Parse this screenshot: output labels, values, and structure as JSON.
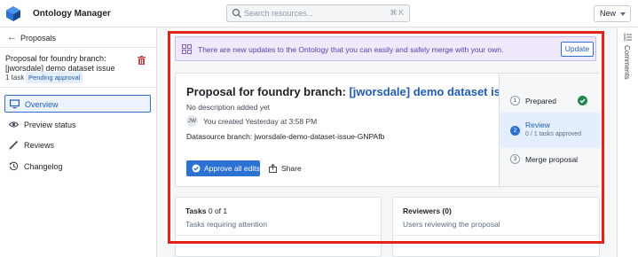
{
  "app": {
    "title": "Ontology Manager"
  },
  "search": {
    "placeholder": "Search resources...",
    "shortcut": "⌘ K"
  },
  "header": {
    "new_label": "New"
  },
  "sidebar": {
    "back_label": "Proposals",
    "proposal_name": "Proposal for foundry branch: [jworsdale] demo dataset issue",
    "task_count": "1 task",
    "status_badge": "Pending approval",
    "nav": [
      {
        "label": "Overview",
        "icon": "monitor-icon",
        "active": true
      },
      {
        "label": "Preview status",
        "icon": "eye-icon",
        "active": false
      },
      {
        "label": "Reviews",
        "icon": "pencil-icon",
        "active": false
      },
      {
        "label": "Changelog",
        "icon": "history-icon",
        "active": false
      }
    ]
  },
  "banner": {
    "message": "There are new updates to the Ontology that you can easily and safely merge with your own.",
    "update_label": "Update"
  },
  "proposal": {
    "title_prefix": "Proposal for foundry branch:",
    "title_link": "[jworsdale] demo dataset issue",
    "description": "No description added yet",
    "avatar_initials": "JW",
    "created_text": "You  created Yesterday at 3:58 PM",
    "datasource_branch": "Datasource branch: jworsdale-demo-dataset-issue-GNPAfb",
    "approve_label": "Approve all edits",
    "share_label": "Share"
  },
  "steps": [
    {
      "num": "1",
      "label": "Prepared",
      "sub": "",
      "state": "done"
    },
    {
      "num": "2",
      "label": "Review",
      "sub": "0 / 1 tasks approved",
      "state": "current"
    },
    {
      "num": "3",
      "label": "Merge proposal",
      "sub": "",
      "state": "pending"
    }
  ],
  "tasks_card": {
    "title": "Tasks",
    "count": "0 of 1",
    "subtitle": "Tasks requiring attention"
  },
  "reviewers_card": {
    "title": "Reviewers (0)",
    "subtitle": "Users reviewing the proposal"
  },
  "rail": {
    "comments_label": "Comments"
  },
  "colors": {
    "accent": "#2d72d2",
    "highlight": "#e02418",
    "banner_bg": "#efe9fb",
    "success": "#238551",
    "danger": "#cd4246"
  }
}
